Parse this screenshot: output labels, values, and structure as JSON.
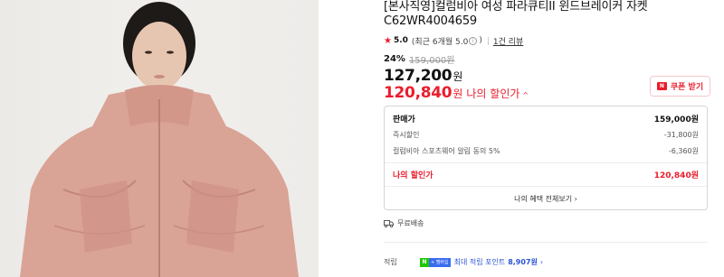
{
  "product": {
    "title_line1": "[본사직영]컬럼비아 여성 파라큐티II 윈드브레이커 자켓",
    "title_line2": "C62WR4004659"
  },
  "rating": {
    "score": "5.0",
    "period_text": "(최근 6개월 5.0",
    "period_close": ")",
    "info_icon": "i",
    "review_link": "1건 리뷰"
  },
  "price": {
    "discount_pct": "24%",
    "original": "159,000원",
    "current": "127,200",
    "current_unit": "원",
    "my_price": "120,840",
    "my_price_unit": "원",
    "my_price_label": "나의 할인가",
    "my_price_chevron": "^"
  },
  "coupon": {
    "icon_text": "N",
    "label": "쿠폰 받기"
  },
  "breakdown": {
    "rows": [
      {
        "label": "판매가",
        "value": "159,000원"
      },
      {
        "label": "즉시할인",
        "value": "-31,800원"
      },
      {
        "label": "컬럼비아 스포츠웨어 알림 동의 5%",
        "value": "-6,360원"
      }
    ],
    "total_label": "나의 할인가",
    "total_value": "120,840원",
    "benefit_link": "나의 혜택 전체보기 ›"
  },
  "delivery": {
    "label": "무료배송"
  },
  "points": {
    "label": "적립",
    "badge_n": "N",
    "badge_m": "+ 멤버십",
    "text": "최대 적립 포인트",
    "value": "8,907원",
    "chevron": "›"
  },
  "colors": {
    "accent": "#ea1d2c",
    "points_blue": "#2a54d4",
    "jacket": "#d9a396"
  }
}
